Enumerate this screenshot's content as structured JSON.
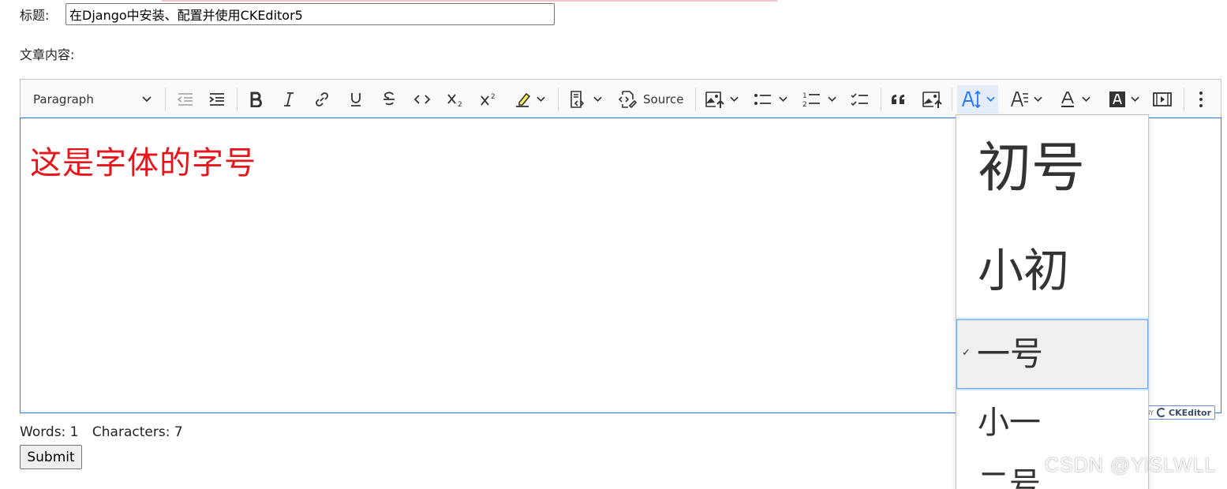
{
  "form": {
    "title_label": "标题:",
    "title_value": "在Django中安装、配置并使用CKEditor5",
    "content_label": "文章内容:",
    "submit_label": "Submit"
  },
  "toolbar": {
    "heading_value": "Paragraph",
    "source_label": "Source",
    "icons": [
      "outdent-icon",
      "indent-icon",
      "bold-icon",
      "italic-icon",
      "link-icon",
      "underline-icon",
      "strikethrough-icon",
      "code-icon",
      "subscript-icon",
      "superscript-icon",
      "highlight-icon",
      "code-block-icon",
      "source-icon",
      "insert-image-icon",
      "bulleted-list-icon",
      "numbered-list-icon",
      "todo-list-icon",
      "blockquote-icon",
      "image-icon",
      "font-size-icon",
      "font-family-icon",
      "font-color-icon",
      "font-background-icon",
      "media-embed-icon",
      "more-icon"
    ]
  },
  "editor": {
    "content_text": "这是字体的字号",
    "content_color": "#e8141b",
    "focus_border_color": "#2977ff"
  },
  "powered_by": {
    "prefix": "BY",
    "brand": "CKEditor"
  },
  "word_count": {
    "words": "Words: 1",
    "characters": "Characters: 7"
  },
  "font_size_dropdown": {
    "items": [
      {
        "label": "初号",
        "selected": false
      },
      {
        "label": "小初",
        "selected": false
      },
      {
        "label": "一号",
        "selected": true
      },
      {
        "label": "小一",
        "selected": false
      },
      {
        "label": "二号",
        "selected": false
      }
    ],
    "check_mark": "✓"
  },
  "watermark": "CSDN @YiSLWLL"
}
